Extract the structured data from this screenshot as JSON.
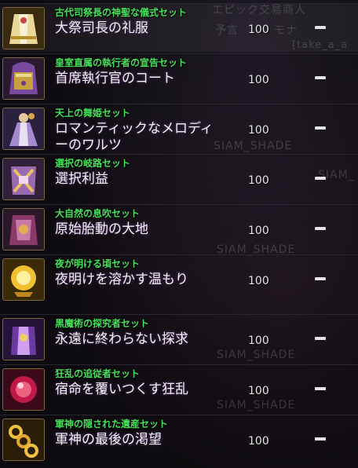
{
  "background_text": {
    "header_line1": "エピック交易商人",
    "header_line2": "予言　　　モナ",
    "header_tag": "[take_a_a",
    "watermarks": [
      "SIAM_SHADE",
      "SIAM_",
      "SIAM_SHADE",
      "SIAM_SHADE",
      "SIAM_SHADE"
    ]
  },
  "colors": {
    "set_name": "#46e25c",
    "item_name": "#f3f3f3",
    "quantity": "#e6e6e6"
  },
  "items": [
    {
      "set_name": "古代司祭長の神聖な儀式セット",
      "item_name": "大祭司長の礼服",
      "quantity": "100",
      "status": "—",
      "icon": "robe-armor-icon"
    },
    {
      "set_name": "皇室直属の執行者の宣告セット",
      "item_name": "首席執行官のコート",
      "quantity": "100",
      "status": "—",
      "icon": "coat-armor-icon"
    },
    {
      "set_name": "天上の舞姫セット",
      "item_name": "ロマンティックなメロディーのワルツ",
      "quantity": "100",
      "status": "—",
      "icon": "dress-armor-icon"
    },
    {
      "set_name": "選択の岐路セット",
      "item_name": "選択利益",
      "quantity": "100",
      "status": "—",
      "icon": "crossroad-armor-icon"
    },
    {
      "set_name": "大自然の息吹セット",
      "item_name": "原始胎動の大地",
      "quantity": "100",
      "status": "—",
      "icon": "nature-armor-icon"
    },
    {
      "set_name": "夜が明ける頃セット",
      "item_name": "夜明けを溶かす温もり",
      "quantity": "100",
      "status": "—",
      "icon": "dawn-orb-icon"
    },
    {
      "set_name": "黒魔術の探究者セット",
      "item_name": "永遠に終わらない探求",
      "quantity": "100",
      "status": "—",
      "icon": "dark-magic-armor-icon"
    },
    {
      "set_name": "狂乱の追従者セット",
      "item_name": "宿命を覆いつくす狂乱",
      "quantity": "100",
      "status": "—",
      "icon": "frenzy-orb-icon"
    },
    {
      "set_name": "軍神の隠された遺産セット",
      "item_name": "軍神の最後の渇望",
      "quantity": "100",
      "status": "—",
      "icon": "war-god-chain-icon"
    }
  ]
}
